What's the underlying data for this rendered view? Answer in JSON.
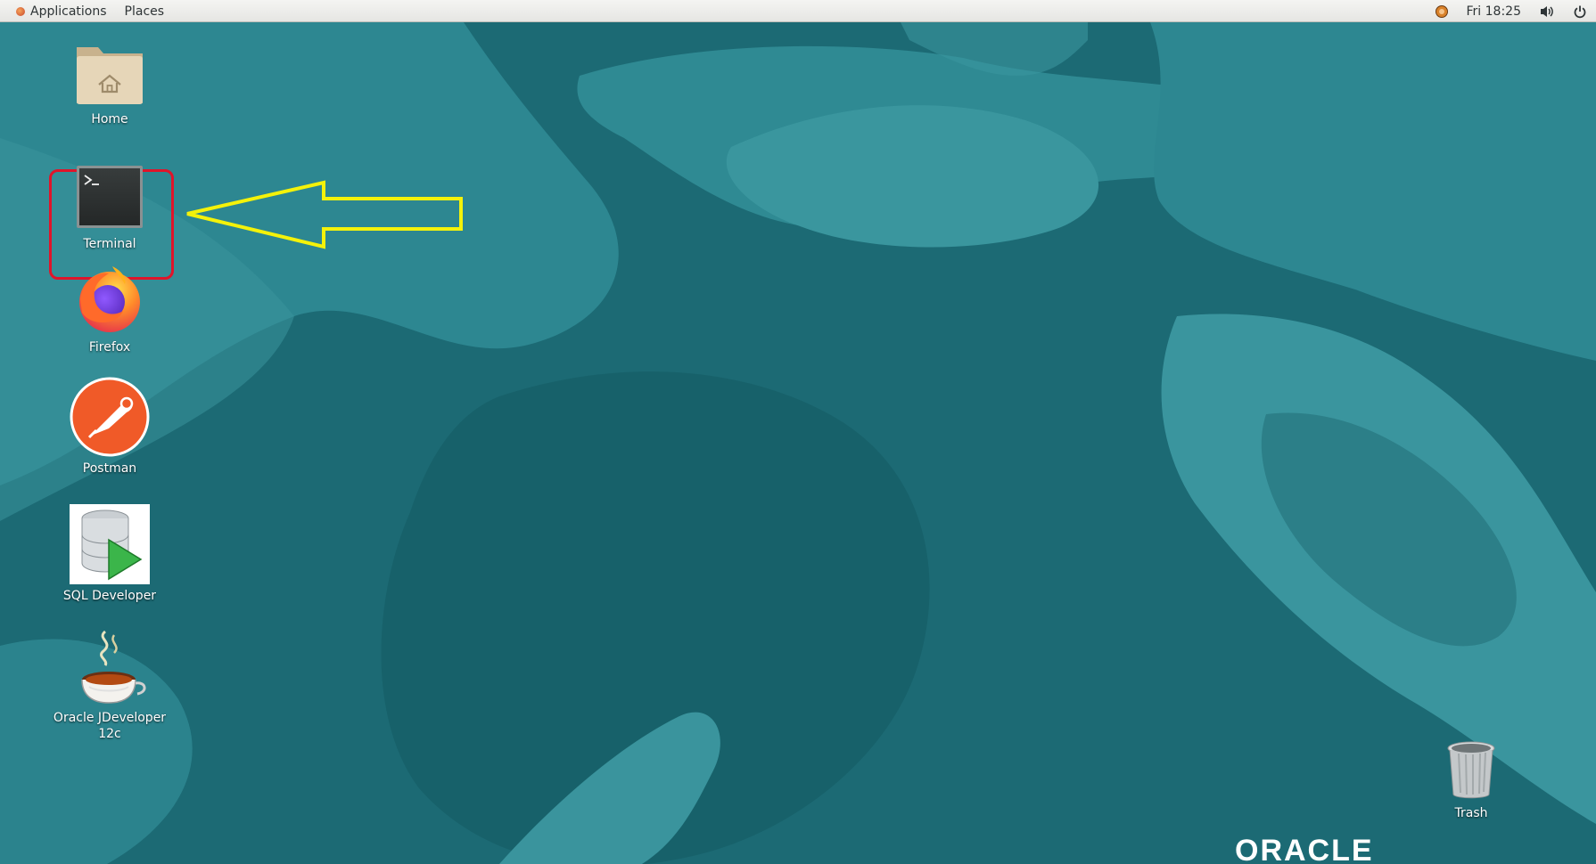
{
  "topbar": {
    "applications_label": "Applications",
    "places_label": "Places",
    "clock": "Fri 18:25"
  },
  "desktop": {
    "icons": [
      {
        "label": "Home"
      },
      {
        "label": "Terminal"
      },
      {
        "label": "Firefox"
      },
      {
        "label": "Postman"
      },
      {
        "label": "SQL Developer"
      },
      {
        "label": "Oracle JDeveloper\n12c"
      },
      {
        "label": "Trash"
      }
    ],
    "logo_text": "ORACLE"
  },
  "annotation": {
    "highlight_color": "#e0142a",
    "arrow_color": "#f4f20a"
  },
  "colors": {
    "desktop_bg": "#1b6872",
    "topbar_bg": "#f0f0ee"
  }
}
